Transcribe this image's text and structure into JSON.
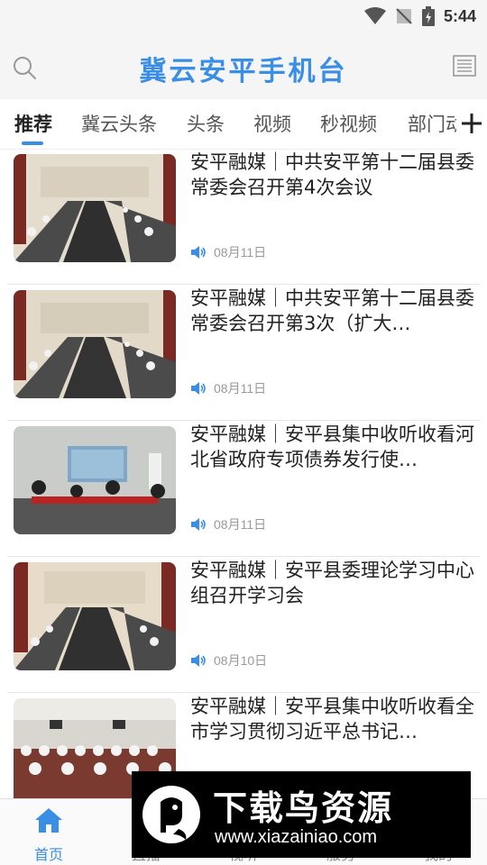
{
  "status_bar": {
    "time": "5:44"
  },
  "header": {
    "title": "冀云安平手机台",
    "accent_color": "#3a8ee6"
  },
  "tabs": [
    {
      "label": "推荐",
      "active": true
    },
    {
      "label": "冀云头条"
    },
    {
      "label": "头条"
    },
    {
      "label": "视频"
    },
    {
      "label": "秒视频"
    },
    {
      "label": "部门动"
    }
  ],
  "icons": {
    "search": "search-icon",
    "news": "newspaper-icon",
    "more": "plus-icon",
    "audio": "speaker-icon",
    "home": "home-icon"
  },
  "news": [
    {
      "title": "安平融媒｜中共安平第十二届县委常委会召开第4次会议",
      "date": "08月11日"
    },
    {
      "title": "安平融媒｜中共安平第十二届县委常委会召开第3次（扩大…",
      "date": "08月11日"
    },
    {
      "title": "安平融媒｜安平县集中收听收看河北省政府专项债券发行使…",
      "date": "08月11日"
    },
    {
      "title": "安平融媒｜安平县委理论学习中心组召开学习会",
      "date": "08月10日"
    },
    {
      "title": "安平融媒｜安平县集中收听收看全市学习贯彻习近平总书记…",
      "date": ""
    }
  ],
  "bottom_nav": [
    {
      "label": "首页",
      "active": true
    },
    {
      "label": "直播"
    },
    {
      "label": "视听"
    },
    {
      "label": "服务"
    },
    {
      "label": "我的"
    }
  ],
  "watermark": {
    "title": "下载鸟资源",
    "url": "www.xiazainiao.com"
  }
}
